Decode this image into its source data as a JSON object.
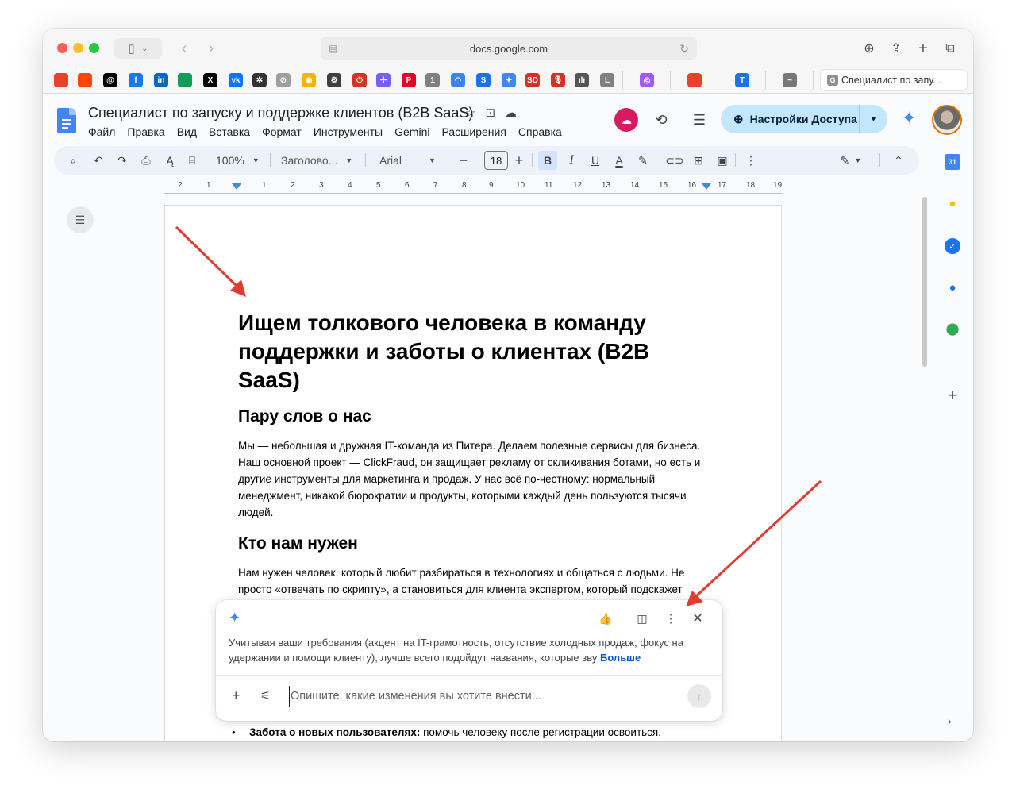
{
  "browser": {
    "address": "docs.google.com",
    "active_tab": "Специалист по запу...",
    "active_tab_icon": "G"
  },
  "favorites": [
    {
      "icon": "gitlab-icon",
      "color": "#e24329",
      "glyph": ""
    },
    {
      "icon": "reddit-icon",
      "color": "#ff4500",
      "glyph": ""
    },
    {
      "icon": "threads-icon",
      "color": "#000000",
      "glyph": "@"
    },
    {
      "icon": "facebook-icon",
      "color": "#1877f2",
      "glyph": "f"
    },
    {
      "icon": "linkedin-icon",
      "color": "#0a66c2",
      "glyph": "in"
    },
    {
      "icon": "sheets-icon",
      "color": "#0f9d58",
      "glyph": ""
    },
    {
      "icon": "x-icon",
      "color": "#000000",
      "glyph": "X"
    },
    {
      "icon": "vk-icon",
      "color": "#0077ff",
      "glyph": "vk"
    },
    {
      "icon": "openai-icon",
      "color": "#333333",
      "glyph": "✲"
    },
    {
      "icon": "compass-icon",
      "color": "#9e9e9e",
      "glyph": "⊘"
    },
    {
      "icon": "coin-icon",
      "color": "#f4b400",
      "glyph": "◉"
    },
    {
      "icon": "settings-icon",
      "color": "#3c4043",
      "glyph": "⚙"
    },
    {
      "icon": "stop-icon",
      "color": "#d93025",
      "glyph": "⏻"
    },
    {
      "icon": "slack-icon",
      "color": "#7c5cff",
      "glyph": "✢"
    },
    {
      "icon": "pinterest-icon",
      "color": "#e60023",
      "glyph": "P"
    },
    {
      "icon": "one-icon",
      "color": "#808080",
      "glyph": "1"
    },
    {
      "icon": "arc-icon",
      "color": "#3b82f6",
      "glyph": "◠"
    },
    {
      "icon": "swap-icon",
      "color": "#1a73e8",
      "glyph": "S"
    },
    {
      "icon": "gemini-icon",
      "color": "#4285f4",
      "glyph": "✦"
    },
    {
      "icon": "sd-icon",
      "color": "#d93025",
      "glyph": "SD"
    },
    {
      "icon": "mic-icon",
      "color": "#d93025",
      "glyph": "🎙"
    },
    {
      "icon": "wave-icon",
      "color": "#555555",
      "glyph": "ılı"
    },
    {
      "icon": "letter-l-icon",
      "color": "#808080",
      "glyph": "L"
    },
    {
      "icon": "podcast-icon",
      "color": "#a259ff",
      "glyph": "◎"
    },
    {
      "icon": "gitlab-icon-2",
      "color": "#e24329",
      "glyph": ""
    },
    {
      "icon": "t-icon",
      "color": "#1a73e8",
      "glyph": "T"
    },
    {
      "icon": "amazon-icon",
      "color": "#777777",
      "glyph": "~"
    }
  ],
  "docs": {
    "title": "Специалист по запуску и поддержке клиентов (B2B SaaS)",
    "menu": [
      "Файл",
      "Правка",
      "Вид",
      "Вставка",
      "Формат",
      "Инструменты",
      "Gemini",
      "Расширения",
      "Справка"
    ],
    "share_label": "Настройки Доступа"
  },
  "toolbar": {
    "zoom": "100%",
    "style": "Заголово...",
    "font": "Arial",
    "font_size": "18"
  },
  "ruler": {
    "numbers": [
      "2",
      "1",
      "1",
      "2",
      "3",
      "4",
      "5",
      "6",
      "7",
      "8",
      "9",
      "10",
      "11",
      "12",
      "13",
      "14",
      "15",
      "16",
      "17",
      "18",
      "19"
    ]
  },
  "document": {
    "h1": "Ищем толкового человека в команду поддержки и заботы о клиентах (B2B SaaS)",
    "h2_about": "Пару слов о нас",
    "p_about": "Мы — небольшая и дружная IT-команда из Питера. Делаем полезные сервисы для бизнеса. Наш основной проект — ClickFraud, он защищает рекламу от скликивания ботами, но есть и другие инструменты для маркетинга и продаж. У нас всё по-честному: нормальный менеджмент, никакой бюрократии и продукты, которыми каждый день пользуются тысячи людей.",
    "h2_need": "Кто нам нужен",
    "p_need": "Нам нужен человек, который любит разбираться в технологиях и общаться с людьми. Не просто «отвечать по скрипту», а становиться для клиента экспертом, который подскажет",
    "bullet_bold": "Забота о новых пользователях:",
    "bullet_text": " помочь человеку после регистрации освоиться,"
  },
  "gemini_popup": {
    "text": "Учитывая ваши требования (акцент на IT-грамотность, отсутствие холодных продаж, фокус на удержании и помощи клиенту), лучше всего подойдут названия, которые зву",
    "more": "Больше",
    "placeholder": "Опишите, какие изменения вы хотите внести..."
  },
  "side_panel": {
    "calendar_day": "31"
  },
  "colors": {
    "accent": "#0b57d0",
    "share_bg": "#c2e7ff",
    "arrow": "#e03c31"
  }
}
